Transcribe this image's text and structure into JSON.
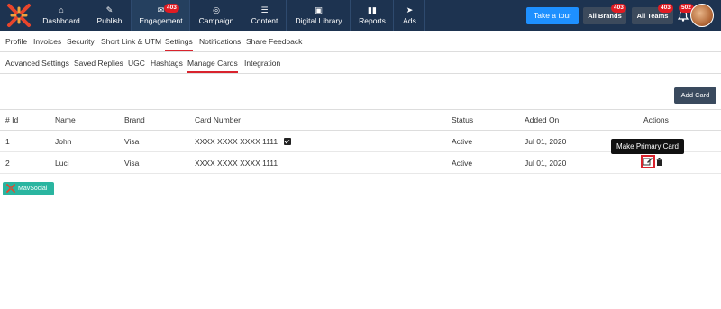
{
  "nav": {
    "items": [
      {
        "label": "Dashboard",
        "icon": "home-icon"
      },
      {
        "label": "Publish",
        "icon": "edit-icon"
      },
      {
        "label": "Engagement",
        "icon": "inbox-icon",
        "badge": "403"
      },
      {
        "label": "Campaign",
        "icon": "target-icon"
      },
      {
        "label": "Content",
        "icon": "list-icon"
      },
      {
        "label": "Digital Library",
        "icon": "briefcase-icon"
      },
      {
        "label": "Reports",
        "icon": "bar-chart-icon"
      },
      {
        "label": "Ads",
        "icon": "send-icon"
      }
    ],
    "take_tour": "Take a tour",
    "all_brands": "All Brands",
    "all_brands_badge": "403",
    "all_teams": "All Teams",
    "all_teams_badge": "403",
    "bell_badge": "502"
  },
  "menu_primary": [
    "Profile",
    "Invoices",
    "Security",
    "Short Link & UTM",
    "Settings",
    "Notifications",
    "Share Feedback"
  ],
  "menu_secondary": [
    "Advanced Settings",
    "Saved Replies",
    "UGC",
    "Hashtags",
    "Manage Cards",
    "Integration"
  ],
  "add_card": "Add Card",
  "table": {
    "headers": [
      "# Id",
      "Name",
      "Brand",
      "Card Number",
      "Status",
      "Added On",
      "Actions"
    ],
    "rows": [
      {
        "id": "1",
        "name": "John",
        "brand": "Visa",
        "card": "XXXX XXXX XXXX 1111",
        "primary": true,
        "status": "Active",
        "added": "Jul 01, 2020"
      },
      {
        "id": "2",
        "name": "Luci",
        "brand": "Visa",
        "card": "XXXX XXXX XXXX 1111",
        "primary": false,
        "status": "Active",
        "added": "Jul 01, 2020"
      }
    ]
  },
  "tooltip": "Make Primary Card",
  "footer_badge": "MavSocial",
  "colors": {
    "nav_bg": "#1d3350",
    "accent_red": "#d9232d",
    "tour_blue": "#1e90ff",
    "teal": "#2ab5a0"
  }
}
